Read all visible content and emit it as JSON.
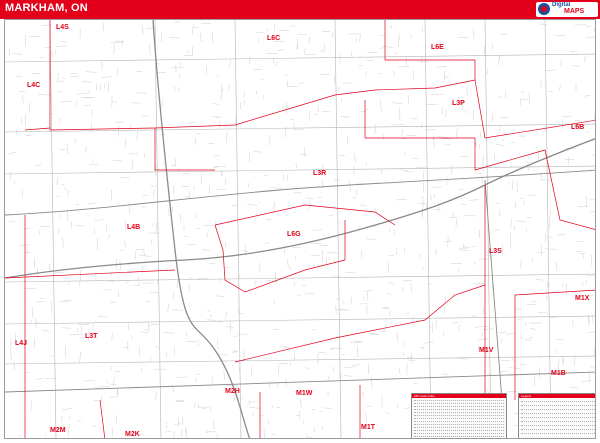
{
  "header": {
    "title": "MARKHAM, ON",
    "logo_line_1": "Digital",
    "logo_line_2": "MAPS",
    "accent_color": "#e2001a"
  },
  "map": {
    "postal_areas": [
      {
        "code": "L4S"
      },
      {
        "code": "L6C"
      },
      {
        "code": "L6E"
      },
      {
        "code": "L4C"
      },
      {
        "code": "L3P"
      },
      {
        "code": "L6B"
      },
      {
        "code": "L3R"
      },
      {
        "code": "L4B"
      },
      {
        "code": "L6G"
      },
      {
        "code": "L3S"
      },
      {
        "code": "L3T"
      },
      {
        "code": "M1X"
      },
      {
        "code": "L4J"
      },
      {
        "code": "M1V"
      },
      {
        "code": "M1B"
      },
      {
        "code": "M2H"
      },
      {
        "code": "M1W"
      },
      {
        "code": "M2M"
      },
      {
        "code": "M2K"
      },
      {
        "code": "M1T"
      }
    ],
    "index_title": "ZIP Code Index",
    "legend_title": "Legend",
    "boundary_color": "#e2001a",
    "street_color": "#c9c9c9",
    "highway_color": "#8a8a8a"
  }
}
